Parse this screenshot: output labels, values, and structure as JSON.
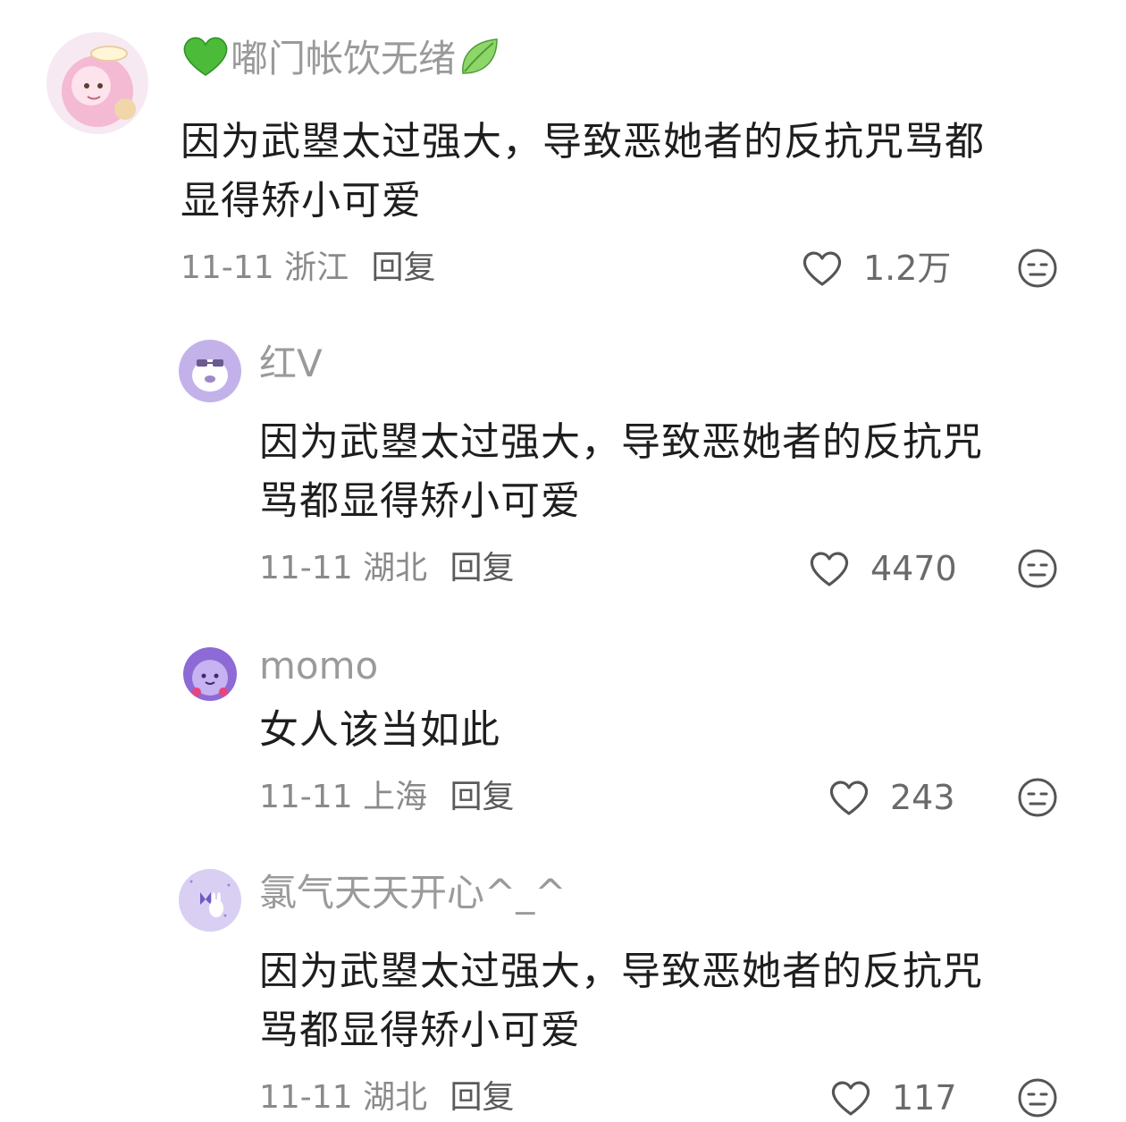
{
  "comments": [
    {
      "username": "嘟门帐饮无绪",
      "username_prefix_emoji": "green-heart",
      "username_suffix_emoji": "leaf",
      "text_lines": [
        "因为武曌太过强大，导致恶她者的反抗咒骂都",
        "显得矫小可爱"
      ],
      "date": "11-11",
      "location": "浙江",
      "reply_label": "回复",
      "likes": "1.2万",
      "avatar_icon": "anime-girl-avatar",
      "level": "top"
    },
    {
      "username": "红V",
      "text_lines": [
        "因为武曌太过强大，导致恶她者的反抗咒",
        "骂都显得矫小可爱"
      ],
      "date": "11-11",
      "location": "湖北",
      "reply_label": "回复",
      "likes": "4470",
      "avatar_icon": "purple-cartoon-avatar",
      "level": "reply"
    },
    {
      "username": "momo",
      "text_lines": [
        "女人该当如此"
      ],
      "date": "11-11",
      "location": "上海",
      "reply_label": "回复",
      "likes": "243",
      "avatar_icon": "purple-blob-avatar",
      "level": "reply"
    },
    {
      "username": "氯气天天开心^_^",
      "text_lines": [
        "因为武曌太过强大，导致恶她者的反抗咒",
        "骂都显得矫小可爱"
      ],
      "date": "11-11",
      "location": "湖北",
      "reply_label": "回复",
      "likes": "117",
      "avatar_icon": "butterfly-bunny-avatar",
      "level": "reply"
    }
  ],
  "icons": {
    "like": "heart-outline-icon",
    "dislike": "meh-face-icon"
  },
  "colors": {
    "text": "#1e1e1e",
    "username": "#9a9a9a",
    "meta": "#8a8a8a",
    "avatar_purple": "#b7a3e6"
  }
}
